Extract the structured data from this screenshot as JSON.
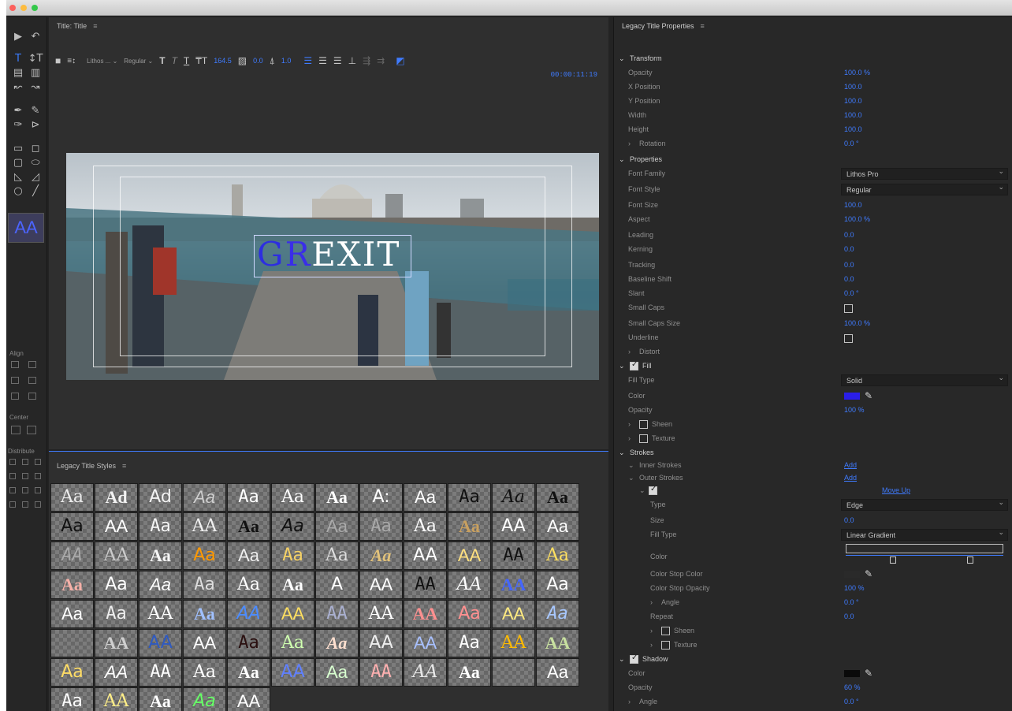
{
  "title_panel": {
    "tab": "Title: Title",
    "font_family": "Lithos ...",
    "font_style": "Regular",
    "font_size": "164.5",
    "kerning": "0.0",
    "leading": "1.0",
    "timecode": "00:00:11:19"
  },
  "canvas": {
    "title_text_a": "G",
    "title_text_b": "R",
    "title_text_c": "EXIT"
  },
  "tools": {
    "align_label": "Align",
    "center_label": "Center",
    "distribute_label": "Distribute",
    "aa_style_preview": "AA"
  },
  "styles_panel": {
    "tab": "Legacy Title Styles",
    "swatches": [
      "Aa",
      "Ad",
      "Ad",
      "Aa",
      "Aa",
      "Aa",
      "Aa",
      "A:",
      "Aa",
      "Aa",
      "Aa",
      "Aa",
      "Aa",
      "AA",
      "Aa",
      "AA",
      "Aa",
      "Aa",
      "Aa",
      "Aa",
      "Aa",
      "Aa",
      "AA",
      "Aa",
      "AA",
      "AA",
      "Aa",
      "Aa",
      "Aa",
      "Aa",
      "Aa",
      "Aa",
      "AA",
      "AA",
      "AA",
      "Aa",
      "Aa",
      "Aa",
      "Aa",
      "Aa",
      "Aa",
      "Aa",
      "A",
      "AA",
      "AA",
      "AA",
      "AA",
      "Aa",
      "Aa",
      "Aa",
      "AA",
      "Aa",
      "AA",
      "AA",
      "AA",
      "AA",
      "AA",
      "Aa",
      "AA",
      "Aa",
      "",
      "AA",
      "AA",
      "AA",
      "Aa",
      "Aa",
      "Aa",
      "AA",
      "AA",
      "Aa",
      "AA",
      "AA",
      "Aa",
      "AA",
      "AA",
      "Aa",
      "Aa",
      "AA",
      "Aa",
      "AA",
      "AA",
      "Aa",
      "",
      "Aa",
      "Aa",
      "AA",
      "Aa",
      "Aa",
      "AA"
    ],
    "swatch_colors": [
      "#ececec",
      "#f2f2f2",
      "#f2f2f2",
      "#cfcfcf",
      "#ffffff",
      "#ffffff",
      "#ffffff",
      "#ffffff",
      "#ffffff",
      "#111111",
      "#111111",
      "#111111",
      "#111111",
      "#ffffff",
      "#f5f5f5",
      "#f0f0f0",
      "#111111",
      "#111111",
      "#aaaaaa",
      "#aaaaaa",
      "#ffffff",
      "#c8a060",
      "#ffffff",
      "#ffffff",
      "#aaaaaa",
      "#cccccc",
      "#f5f5f5",
      "#ff9900",
      "#eeeeee",
      "#f6d266",
      "#dddddd",
      "#e2c27a",
      "#ffffff",
      "#ffe080",
      "#111111",
      "#ffe060",
      "#f6b0a8",
      "#ffffff",
      "#ffffff",
      "#dddddd",
      "#ffffff",
      "#ffffff",
      "#ffffff",
      "#ffffff",
      "#111111",
      "#ffffff",
      "#4466ff",
      "#ffffff",
      "#ffffff",
      "#eeeeee",
      "#ffffff",
      "#a0c0ff",
      "#4c8cff",
      "#ffe060",
      "#aab0d0",
      "#ffffff",
      "#ff9090",
      "#ff9090",
      "#ffeb80",
      "#a8c8ff",
      "#bbbbbb",
      "#cfcfcf",
      "#2f5ac0",
      "#ffffff",
      "#2a1010",
      "#cfffb0",
      "#ffe0d0",
      "#eeeeee",
      "#a8c0ff",
      "#ffffff",
      "#ffbb00",
      "#c8e0a0",
      "#ffdd66",
      "#ffffff",
      "#ffffff",
      "#ffffff",
      "#ffffff",
      "#6080ff",
      "#d8ffd0",
      "#ffb0b0",
      "#e8e8e8",
      "#ffffff",
      "#ffffff",
      "#ffffff",
      "#ffffff",
      "#ffee88",
      "#ffffff",
      "#66ff66",
      "#ffffff"
    ]
  },
  "props": {
    "title": "Legacy Title Properties",
    "transform": "Transform",
    "opacity_l": "Opacity",
    "opacity": "100.0 %",
    "xpos_l": "X Position",
    "xpos": "100.0",
    "ypos_l": "Y Position",
    "ypos": "100.0",
    "width_l": "Width",
    "width": "100.0",
    "height_l": "Height",
    "height": "100.0",
    "rotation_l": "Rotation",
    "rotation": "0.0 °",
    "properties": "Properties",
    "ff_l": "Font Family",
    "ff": "Lithos Pro",
    "fs_l": "Font Style",
    "fs": "Regular",
    "fsize_l": "Font Size",
    "fsize": "100.0",
    "aspect_l": "Aspect",
    "aspect": "100.0 %",
    "leading_l": "Leading",
    "leading": "0.0",
    "kerning_l": "Kerning",
    "kerning": "0.0",
    "tracking_l": "Tracking",
    "tracking": "0.0",
    "bshift_l": "Baseline Shift",
    "bshift": "0.0",
    "slant_l": "Slant",
    "slant": "0.0 °",
    "smallcaps_l": "Small Caps",
    "scsize_l": "Small Caps Size",
    "scsize": "100.0 %",
    "underline_l": "Underline",
    "distort_l": "Distort",
    "fill": "Fill",
    "filltype_l": "Fill Type",
    "filltype": "Solid",
    "color_l": "Color",
    "fill_color": "#2a1ee8",
    "fopacity_l": "Opacity",
    "fopacity": "100 %",
    "sheen_l": "Sheen",
    "texture_l": "Texture",
    "strokes": "Strokes",
    "inner_l": "Inner Strokes",
    "inner_add": "Add",
    "outer_l": "Outer Strokes",
    "outer_add": "Add",
    "moveup": "Move Up",
    "type_l": "Type",
    "type": "Edge",
    "size_l": "Size",
    "size": "0.0",
    "sfilltype_l": "Fill Type",
    "sfilltype": "Linear Gradient",
    "scolor_l": "Color",
    "csc_l": "Color Stop Color",
    "cso_l": "Color Stop Opacity",
    "cso": "100 %",
    "angle_l": "Angle",
    "angle": "0.0 °",
    "repeat_l": "Repeat",
    "repeat": "0.0",
    "ssheen_l": "Sheen",
    "stexture_l": "Texture",
    "shadow": "Shadow",
    "shcolor_l": "Color",
    "shadow_color": "#0a0a0a",
    "shopacity_l": "Opacity",
    "shopacity": "60 %",
    "shangle_l": "Angle",
    "shangle": "0.0 °"
  }
}
